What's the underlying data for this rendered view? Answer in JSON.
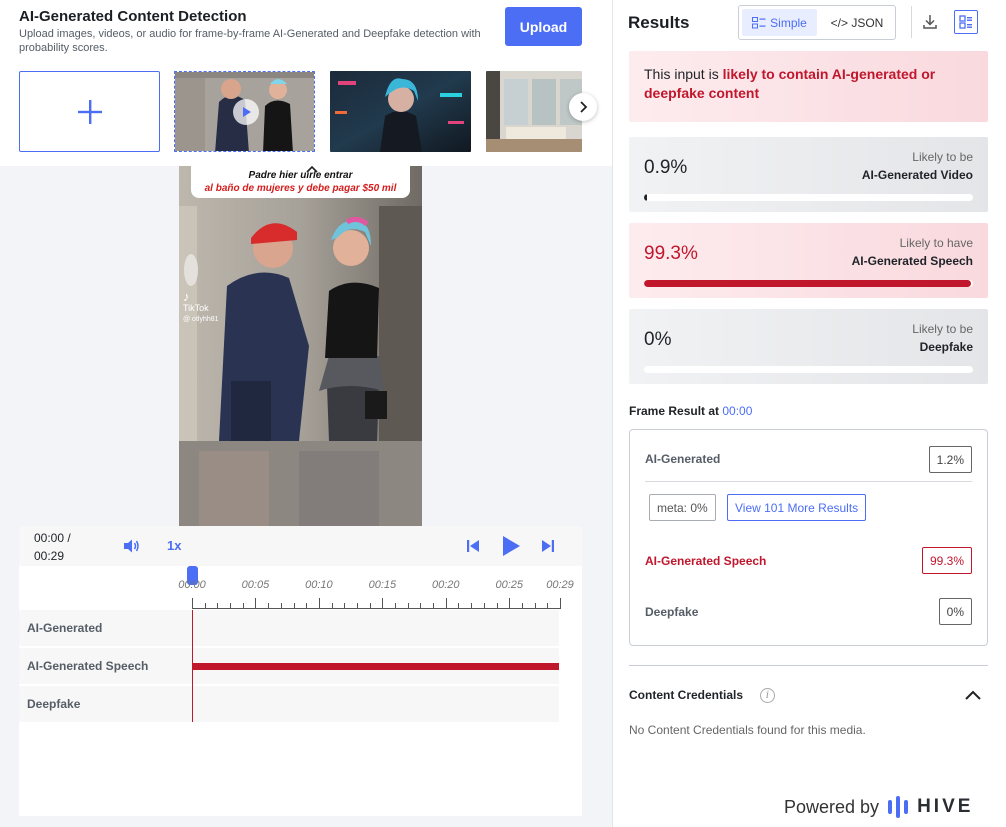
{
  "header": {
    "title": "AI-Generated Content Detection",
    "subtitle": "Upload images, videos, or audio for frame-by-frame AI-Generated and Deepfake detection with probability scores.",
    "upload_label": "Upload"
  },
  "video": {
    "caption_line1": "Padre hier          uirle entrar",
    "caption_line2": "al baño de mujeres y debe pagar $50 mil",
    "watermark": "TikTok",
    "watermark_handle": "@ otlyhh81"
  },
  "player": {
    "current_time": "00:00 /",
    "duration": "00:29",
    "speed": "1x",
    "timeline_labels": [
      "00:00",
      "00:05",
      "00:10",
      "00:15",
      "00:20",
      "00:25",
      "00:29"
    ],
    "tracks": [
      {
        "label": "AI-Generated",
        "fill": 0
      },
      {
        "label": "AI-Generated Speech",
        "fill": 1
      },
      {
        "label": "Deepfake",
        "fill": 0
      }
    ]
  },
  "results": {
    "title": "Results",
    "view_simple": "Simple",
    "view_json": "</> JSON",
    "verdict_prefix": "This input is ",
    "verdict_emphasis": "likely to contain AI-generated or deepfake content",
    "cards": [
      {
        "pct": "0.9%",
        "value": 0.009,
        "label1": "Likely to be",
        "label2": "AI-Generated Video",
        "style": "gray"
      },
      {
        "pct": "99.3%",
        "value": 0.993,
        "label1": "Likely to have",
        "label2": "AI-Generated Speech",
        "style": "pink"
      },
      {
        "pct": "0%",
        "value": 0,
        "label1": "Likely to be",
        "label2": "Deepfake",
        "style": "gray"
      }
    ],
    "frame_result_label": "Frame Result at",
    "frame_result_time": "00:00",
    "frame_rows": {
      "ai_generated_label": "AI-Generated",
      "ai_generated_value": "1.2%",
      "meta_chip": "meta: 0%",
      "more_results": "View 101 More Results",
      "speech_label": "AI-Generated Speech",
      "speech_value": "99.3%",
      "deepfake_label": "Deepfake",
      "deepfake_value": "0%"
    },
    "content_credentials_title": "Content Credentials",
    "content_credentials_note": "No Content Credentials found for this media.",
    "powered_by": "Powered by",
    "brand": "HIVE"
  },
  "colors": {
    "accent": "#4c6ef5",
    "danger": "#c0172d"
  },
  "icons": [
    "plus-icon",
    "play-icon",
    "chevron-right-icon",
    "chevron-up-icon",
    "volume-icon",
    "skip-back-icon",
    "skip-forward-icon",
    "simple-view-icon",
    "download-icon",
    "list-view-icon",
    "info-icon",
    "hive-logo-icon"
  ]
}
